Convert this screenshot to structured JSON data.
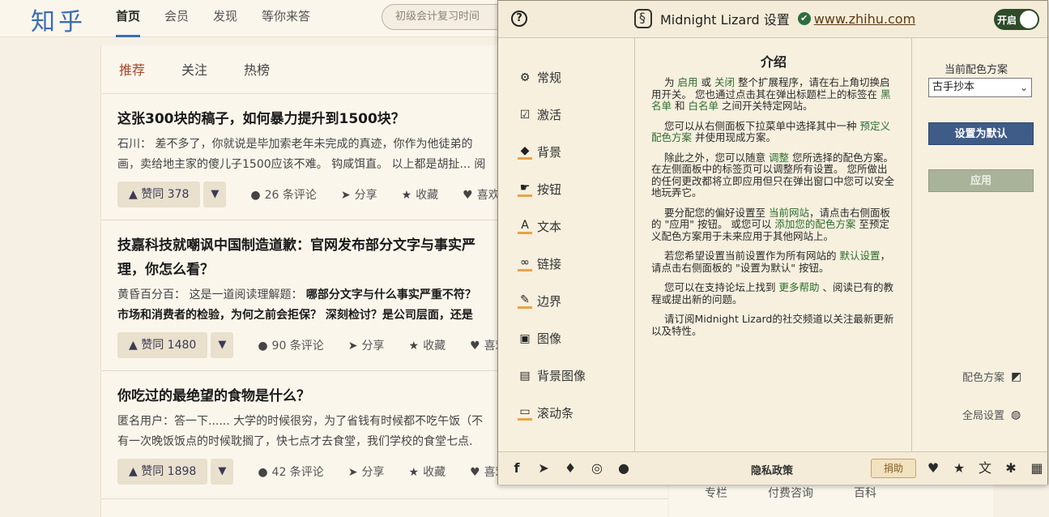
{
  "header": {
    "logo": "知乎",
    "nav": [
      "首页",
      "会员",
      "发现",
      "等你来答"
    ],
    "search_placeholder": "初级会计复习时间"
  },
  "feed": {
    "tabs": [
      "推荐",
      "关注",
      "热榜"
    ],
    "items": [
      {
        "title": "这张300块的稿子，如何暴力提升到1500块？",
        "excerpt_a": "石川： 差不多了，你就说是毕加索老年未完成的真迹，你作为他徒弟的",
        "excerpt_b": "画，卖给地主家的傻儿子1500应该不难。 钩咸饵直。 以上都是胡扯... 阅",
        "votes": "赞同 378",
        "comments": "26 条评论"
      },
      {
        "title": "技嘉科技就嘲讽中国制造道歉：官网发布部分文字与事实严重不符，请合理，你怎么看？",
        "title_line1": "技嘉科技就嘲讽中国制造道歉：官网发布部分文字与事实严",
        "title_line2": "理，你怎么看？",
        "excerpt_a_plain": "黄昏百分百： 这是一道阅读理解题： ",
        "excerpt_a_bold": "哪部分文字与什么事实严重不符？",
        "excerpt_b_bold": "市场和消费者的检验，为何之前会拒保？ 深刻检讨？是公司层面，还是",
        "votes": "赞同 1480",
        "comments": "90 条评论"
      },
      {
        "title": "你吃过的最绝望的食物是什么？",
        "excerpt_a": "匿名用户：答一下...... 大学的时候很穷，为了省钱有时候都不吃午饭（不",
        "excerpt_b": "有一次晚饭饭点的时候耽搁了，快七点才去食堂，我们学校的食堂七点.",
        "votes": "赞同 1898",
        "comments": "42 条评论"
      }
    ],
    "share": "分享",
    "favorite": "收藏",
    "like": "喜欢"
  },
  "right_links": [
    "专栏",
    "付费咨询",
    "百科"
  ],
  "popup": {
    "title": "Midnight Lizard 设置",
    "site": "www.zhihu.com",
    "toggle_label": "开启",
    "side_menu": [
      "常规",
      "激活",
      "背景",
      "按钮",
      "文本",
      "链接",
      "边界",
      "图像",
      "背景图像",
      "滚动条"
    ],
    "main_heading": "介绍",
    "paragraphs": {
      "p1a": "为 ",
      "p1g1": "启用",
      "p1b": " 或 ",
      "p1g2": "关闭",
      "p1c": " 整个扩展程序，请在右上角切换启用开关。 您也通过点击其在弹出标题栏上的标签在 ",
      "p1g3": "黑名单",
      "p1d": " 和 ",
      "p1g4": "白名单",
      "p1e": " 之间开关特定网站。",
      "p2a": "您可以从右侧面板下拉菜单中选择其中一种 ",
      "p2g": "预定义配色方案",
      "p2b": " 并使用现成方案。",
      "p3a": "除此之外，您可以随意 ",
      "p3g": "调整",
      "p3b": " 您所选择的配色方案。 在左侧面板中的标签页可以调整所有设置。 您所做出的任何更改都将立即应用但只在弹出窗口中您可以安全地玩弄它。",
      "p4a": "要分配您的偏好设置至 ",
      "p4g1": "当前网站",
      "p4b": "，请点击右侧面板的 \"应用\" 按钮。 或您可以 ",
      "p4g2": "添加您的配色方案",
      "p4c": " 至预定义配色方案用于未来应用于其他网站上。",
      "p5a": "若您希望设置当前设置作为所有网站的 ",
      "p5g": "默认设置",
      "p5b": "，请点击右侧面板的 \"设置为默认\" 按钮。",
      "p6a": "您可以在支持论坛上找到 ",
      "p6g": "更多帮助",
      "p6b": " 、阅读已有的教程或提出新的问题。",
      "p7": "请订阅Midnight Lizard的社交频道以关注最新更新以及特性。"
    },
    "scheme_label": "当前配色方案",
    "scheme_selected": "古手抄本",
    "btn_default": "设置为默认",
    "btn_apply": "应用",
    "link_schemes": "配色方案",
    "link_global": "全局设置",
    "privacy": "隐私政策",
    "donate": "捐助"
  },
  "colors": {
    "accent": "#3c6db4",
    "popup_bg": "#f7f0df",
    "green_text": "#2c6d2c",
    "button_blue": "#3f5c88"
  }
}
